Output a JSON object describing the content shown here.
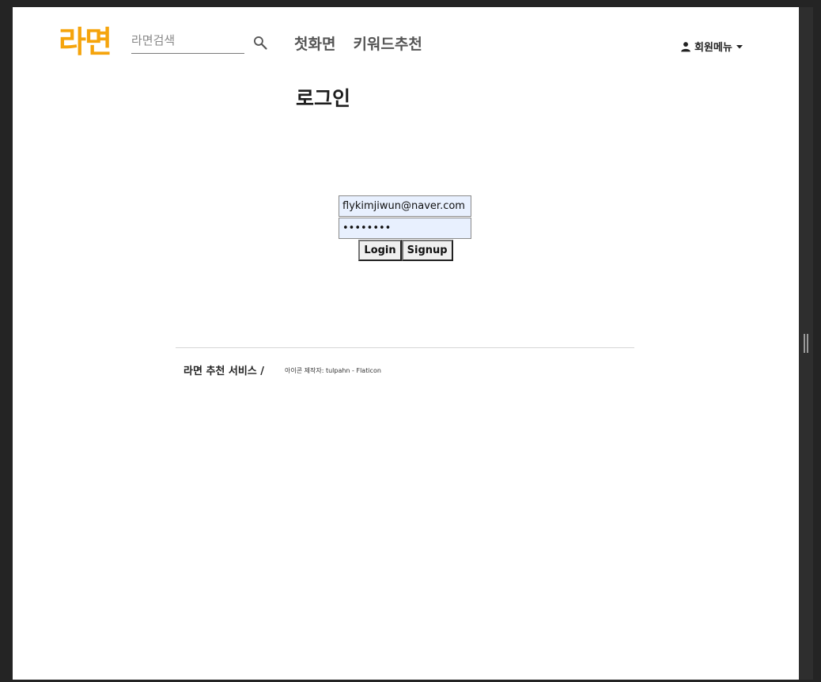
{
  "header": {
    "logo_text": "라면",
    "search": {
      "placeholder": "라면검색",
      "value": ""
    },
    "nav": {
      "home": "첫화면",
      "keyword": "키워드추천"
    },
    "user_menu_label": "회원메뉴"
  },
  "main": {
    "title": "로그인",
    "form": {
      "email_value": "flykimjiwun@naver.com",
      "password_value": "********",
      "login_label": "Login",
      "signup_label": "Signup"
    }
  },
  "footer": {
    "title": "라면 추천 서비스 /",
    "credit": "아이콘 제작자: tulpahn - Flaticon"
  },
  "icons": {
    "search": "search-icon",
    "user": "user-icon",
    "caret": "caret-down-icon"
  },
  "colors": {
    "logo": "#f5a40c",
    "nav_text": "#555555",
    "field_bg": "#e8f0fe"
  }
}
